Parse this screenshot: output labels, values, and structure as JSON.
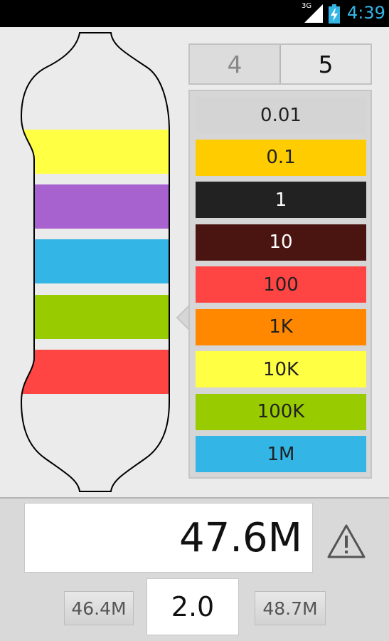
{
  "status_bar": {
    "network": "3G",
    "time": "4:39",
    "accent": "#33b5e5"
  },
  "band_count": {
    "options": [
      "4",
      "5"
    ],
    "selected": "5"
  },
  "resistor": {
    "bands": [
      {
        "name": "yellow",
        "color": "#ffff44"
      },
      {
        "name": "violet",
        "color": "#a862cf"
      },
      {
        "name": "blue",
        "color": "#33b5e5"
      },
      {
        "name": "green",
        "color": "#99cc00"
      },
      {
        "name": "red",
        "color": "#ff4444"
      }
    ],
    "body_color": "#ebebeb"
  },
  "multiplier_picker": {
    "items": [
      {
        "label": "0.01",
        "bg": "#d4d4d4",
        "fg": "#222222"
      },
      {
        "label": "0.1",
        "bg": "#ffcc00",
        "fg": "#222222"
      },
      {
        "label": "1",
        "bg": "#222222",
        "fg": "#ffffff"
      },
      {
        "label": "10",
        "bg": "#4a1510",
        "fg": "#ffffff"
      },
      {
        "label": "100",
        "bg": "#ff4444",
        "fg": "#222222"
      },
      {
        "label": "1K",
        "bg": "#ff8800",
        "fg": "#222222"
      },
      {
        "label": "10K",
        "bg": "#ffff44",
        "fg": "#222222"
      },
      {
        "label": "100K",
        "bg": "#99cc00",
        "fg": "#222222"
      },
      {
        "label": "1M",
        "bg": "#33b5e5",
        "fg": "#222222"
      }
    ]
  },
  "result": {
    "value": "47.6M",
    "warning_icon": "warning-triangle-icon"
  },
  "tolerance": {
    "min": "46.4M",
    "percent": "2.0",
    "max": "48.7M"
  }
}
